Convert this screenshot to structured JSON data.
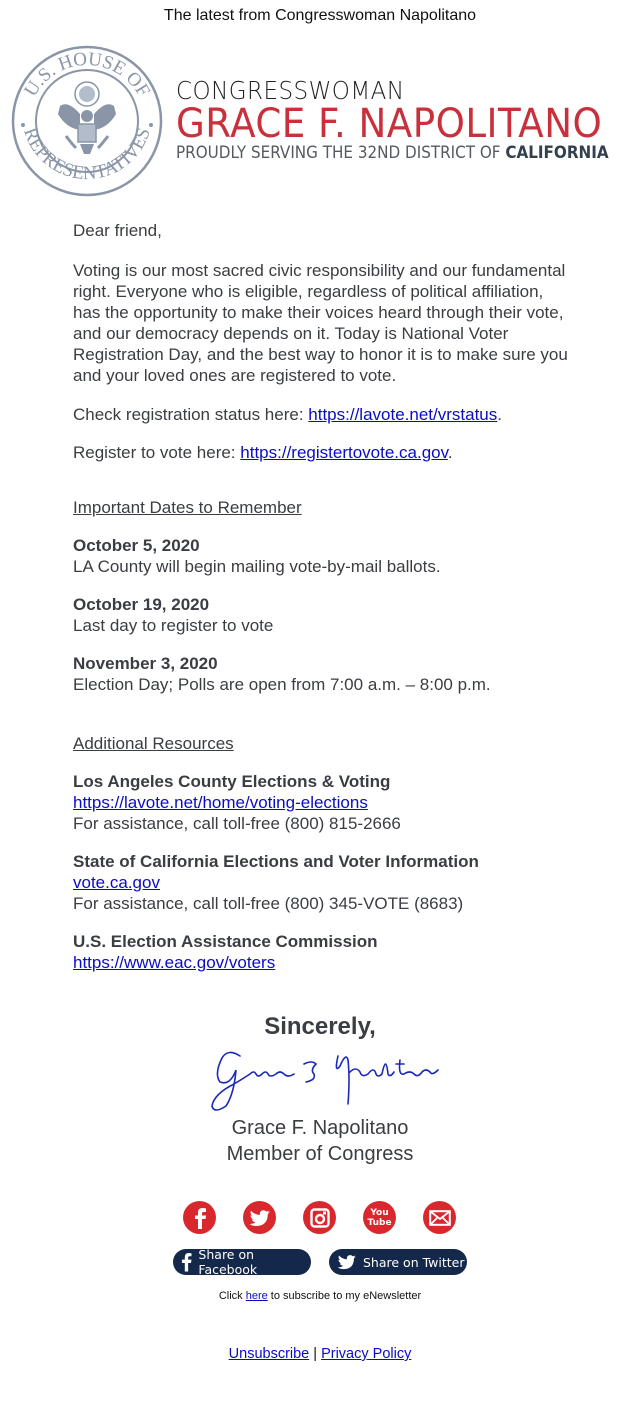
{
  "preheader": "The latest from Congresswoman Napolitano",
  "banner": {
    "seal_text_top": "U.S. HOUSE OF",
    "seal_text_bottom": "REPRESENTATIVES",
    "title_line1": "CONGRESSWOMAN",
    "title_name": "GRACE F. NAPOLITANO",
    "title_line3_prefix": "PROUDLY SERVING THE 32ND DISTRICT OF",
    "title_line3_state": "CALIFORNIA",
    "colors": {
      "name_red": "#c8313c",
      "seal_gray": "#8a96a8"
    }
  },
  "letter": {
    "greeting": "Dear friend,",
    "intro": "Voting is our most sacred civic responsibility and our fundamental right. Everyone who is eligible, regardless of political affiliation, has the opportunity to make their voices heard through their vote, and our democracy depends on it. Today is National Voter Registration Day, and the best way to honor it is to make sure you and your loved ones are registered to vote.",
    "check_status_label": "Check registration status here: ",
    "check_status_link": "https://lavote.net/vrstatus",
    "register_label": "Register to vote here: ",
    "register_link": "https://registertovote.ca.gov",
    "period": "."
  },
  "dates": {
    "title": "Important Dates to Remember",
    "items": [
      {
        "date": "October 5, 2020",
        "desc": "LA County will begin mailing vote-by-mail ballots."
      },
      {
        "date": "October 19, 2020",
        "desc": "Last day to register to vote"
      },
      {
        "date": "November 3, 2020",
        "desc": "Election Day; Polls are open from 7:00 a.m. – 8:00 p.m."
      }
    ]
  },
  "resources": {
    "title": "Additional Resources",
    "items": [
      {
        "name": "Los Angeles County Elections & Voting",
        "link": "https://lavote.net/home/voting-elections",
        "note": "For assistance, call toll-free (800) 815-2666"
      },
      {
        "name": "State of California Elections and Voter Information",
        "link": "vote.ca.gov",
        "note": "For assistance, call toll-free (800) 345-VOTE (8683)"
      },
      {
        "name": "U.S. Election Assistance Commission",
        "link": "https://www.eac.gov/voters"
      }
    ]
  },
  "closing": {
    "sincerely": "Sincerely,",
    "name": "Grace F. Napolitano",
    "title": "Member of Congress"
  },
  "social": {
    "icons": [
      "facebook-icon",
      "twitter-icon",
      "instagram-icon",
      "youtube-icon",
      "email-icon"
    ],
    "youtube_text_top": "You",
    "youtube_text_bottom": "Tube",
    "share_facebook": "Share on Facebook",
    "share_twitter": "Share on Twitter",
    "colors": {
      "icon_red": "#d9272e",
      "share_navy": "#13284a"
    }
  },
  "subscribe": {
    "prefix": "Click ",
    "link": "here",
    "suffix": " to subscribe to my eNewsletter"
  },
  "footer": {
    "unsubscribe": "Unsubscribe",
    "separator": " | ",
    "privacy": "Privacy Policy"
  }
}
